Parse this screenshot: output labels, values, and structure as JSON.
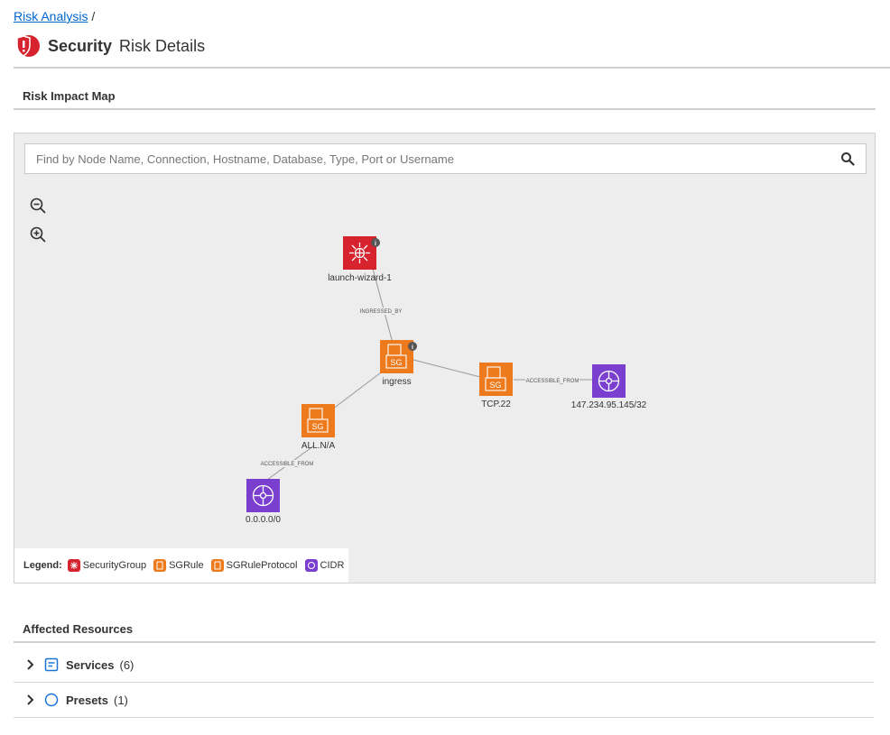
{
  "breadcrumb": {
    "link": "Risk Analysis",
    "separator": "/"
  },
  "title": {
    "strong": "Security",
    "light": "Risk Details"
  },
  "risk_map": {
    "heading": "Risk Impact Map",
    "search_placeholder": "Find by Node Name, Connection, Hostname, Database, Type, Port or Username",
    "nodes": [
      {
        "label": "launch-wizard-1",
        "type": "SecurityGroup"
      },
      {
        "label": "ingress",
        "type": "SGRule"
      },
      {
        "label": "TCP.22",
        "type": "SGRuleProtocol"
      },
      {
        "label": "147.234.95.145/32",
        "type": "CIDR"
      },
      {
        "label": "ALL.N/A",
        "type": "SGRuleProtocol"
      },
      {
        "label": "0.0.0.0/0",
        "type": "CIDR"
      }
    ],
    "edges": [
      {
        "label": "INGRESSED_BY"
      },
      {
        "label": "ACCESSIBLE_FROM"
      },
      {
        "label": "ACCESSIBLE_FROM"
      }
    ],
    "sg_glyph": "SG",
    "legend": {
      "title": "Legend:",
      "items": [
        {
          "label": "SecurityGroup",
          "color": "#d6232e"
        },
        {
          "label": "SGRule",
          "color": "#ed7a1c"
        },
        {
          "label": "SGRuleProtocol",
          "color": "#ed7a1c"
        },
        {
          "label": "CIDR",
          "color": "#7b3fd0"
        }
      ]
    }
  },
  "affected": {
    "heading": "Affected Resources",
    "rows": [
      {
        "label": "Services",
        "count": "(6)",
        "icon": "list-icon"
      },
      {
        "label": "Presets",
        "count": "(1)",
        "icon": "circle-icon"
      }
    ]
  },
  "colors": {
    "link": "#0066cc",
    "security_red": "#d6232e",
    "rule_orange": "#ed7a1c",
    "cidr_purple": "#7b3fd0",
    "accent_blue": "#1a73d9"
  }
}
